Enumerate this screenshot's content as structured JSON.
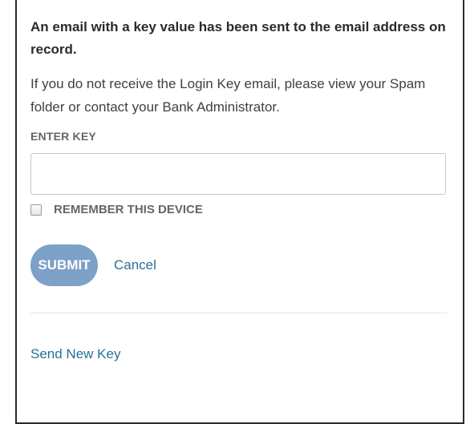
{
  "message": {
    "headline": "An email with a key value has been sent to the email address on record.",
    "info": "If you do not receive the Login Key email, please view your Spam folder or contact your Bank Administrator."
  },
  "key_field": {
    "label": "ENTER KEY",
    "value": "",
    "placeholder": ""
  },
  "remember_device": {
    "label": "REMEMBER THIS DEVICE",
    "checked": false
  },
  "actions": {
    "submit_label": "SUBMIT",
    "cancel_label": "Cancel"
  },
  "footer": {
    "send_new_key_label": "Send New Key"
  },
  "colors": {
    "submit_bg": "#7da1c8",
    "link": "#2a6f97",
    "border": "#2b2b2b"
  }
}
